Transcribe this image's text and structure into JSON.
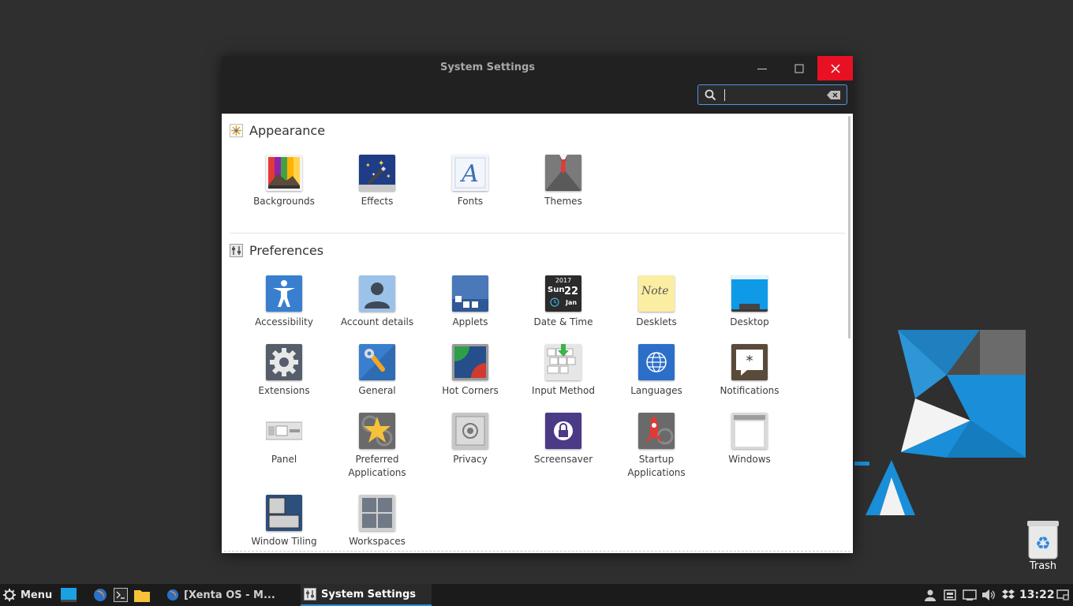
{
  "window": {
    "title": "System Settings",
    "search": {
      "value": "",
      "placeholder": ""
    }
  },
  "sections": [
    {
      "title": "Appearance",
      "items": [
        {
          "label": "Backgrounds",
          "icon": "backgrounds-icon"
        },
        {
          "label": "Effects",
          "icon": "effects-icon"
        },
        {
          "label": "Fonts",
          "icon": "fonts-icon"
        },
        {
          "label": "Themes",
          "icon": "themes-icon"
        }
      ]
    },
    {
      "title": "Preferences",
      "items": [
        {
          "label": "Accessibility",
          "icon": "accessibility-icon"
        },
        {
          "label": "Account details",
          "icon": "account-details-icon"
        },
        {
          "label": "Applets",
          "icon": "applets-icon"
        },
        {
          "label": "Date & Time",
          "icon": "date-time-icon",
          "icon_text": {
            "year": "2017",
            "day": "Sun",
            "date": "22",
            "month": "Jan"
          }
        },
        {
          "label": "Desklets",
          "icon": "desklets-icon",
          "icon_text": "Note"
        },
        {
          "label": "Desktop",
          "icon": "desktop-icon"
        },
        {
          "label": "Extensions",
          "icon": "extensions-icon"
        },
        {
          "label": "General",
          "icon": "general-icon"
        },
        {
          "label": "Hot Corners",
          "icon": "hot-corners-icon"
        },
        {
          "label": "Input Method",
          "icon": "input-method-icon"
        },
        {
          "label": "Languages",
          "icon": "languages-icon"
        },
        {
          "label": "Notifications",
          "icon": "notifications-icon"
        },
        {
          "label": "Panel",
          "icon": "panel-icon"
        },
        {
          "label": "Preferred Applications",
          "label_lines": [
            "Preferred",
            "Applications"
          ],
          "icon": "preferred-applications-icon"
        },
        {
          "label": "Privacy",
          "icon": "privacy-icon"
        },
        {
          "label": "Screensaver",
          "icon": "screensaver-icon"
        },
        {
          "label": "Startup Applications",
          "label_lines": [
            "Startup",
            "Applications"
          ],
          "icon": "startup-applications-icon"
        },
        {
          "label": "Windows",
          "icon": "windows-icon"
        },
        {
          "label": "Window Tiling",
          "icon": "window-tiling-icon"
        },
        {
          "label": "Workspaces",
          "icon": "workspaces-icon"
        }
      ]
    }
  ],
  "desktop": {
    "trash_label": "Trash"
  },
  "panel": {
    "menu_label": "Menu",
    "tasks": [
      {
        "label": "[Xenta OS - M..."
      },
      {
        "label": "System Settings"
      }
    ],
    "clock": "13:22"
  },
  "colors": {
    "accent": "#2a8ae0",
    "close_button": "#e81123",
    "titlebar": "#212121",
    "panel": "#1b1b1b"
  }
}
